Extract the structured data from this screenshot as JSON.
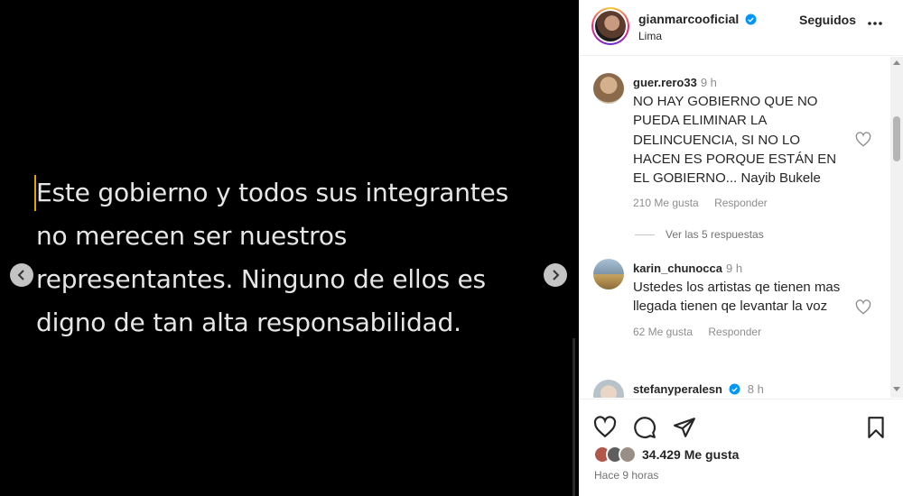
{
  "post": {
    "text_lines": [
      "Este gobierno y todos sus integrantes",
      "no merecen ser nuestros",
      "representantes. Ninguno de ellos es",
      "digno de tan alta responsabilidad."
    ]
  },
  "header": {
    "username": "gianmarcooficial",
    "location": "Lima",
    "follow_label": "Seguidos"
  },
  "comments": [
    {
      "user": "guer.rero33",
      "time": "9 h",
      "text": "NO HAY GOBIERNO QUE NO PUEDA ELIMINAR LA DELINCUENCIA, SI NO LO HACEN ES PORQUE ESTÁN EN EL GOBIERNO... Nayib Bukele",
      "likes": "210 Me gusta",
      "reply_label": "Responder",
      "view_replies": "Ver las 5 respuestas"
    },
    {
      "user": "karin_chunocca",
      "time": "9 h",
      "text": "Ustedes los artistas qe tienen mas llegada tienen qe levantar la voz",
      "likes": "62 Me gusta",
      "reply_label": "Responder"
    },
    {
      "user": "stefanyperalesn",
      "time": "8 h",
      "verified": true
    }
  ],
  "footer": {
    "likes_count": "34.429 Me gusta",
    "posted_ago": "Hace 9 horas"
  },
  "icons": {
    "prev": "chevron-left-icon",
    "next": "chevron-right-icon",
    "like": "heart-icon",
    "comment": "comment-icon",
    "share": "share-icon",
    "save": "bookmark-icon",
    "more": "more-icon",
    "verified": "verified-badge-icon"
  },
  "colors": {
    "verified": "#0095f6",
    "caret": "#e0a400",
    "text_primary": "#262626",
    "text_secondary": "#8e8e8e"
  }
}
